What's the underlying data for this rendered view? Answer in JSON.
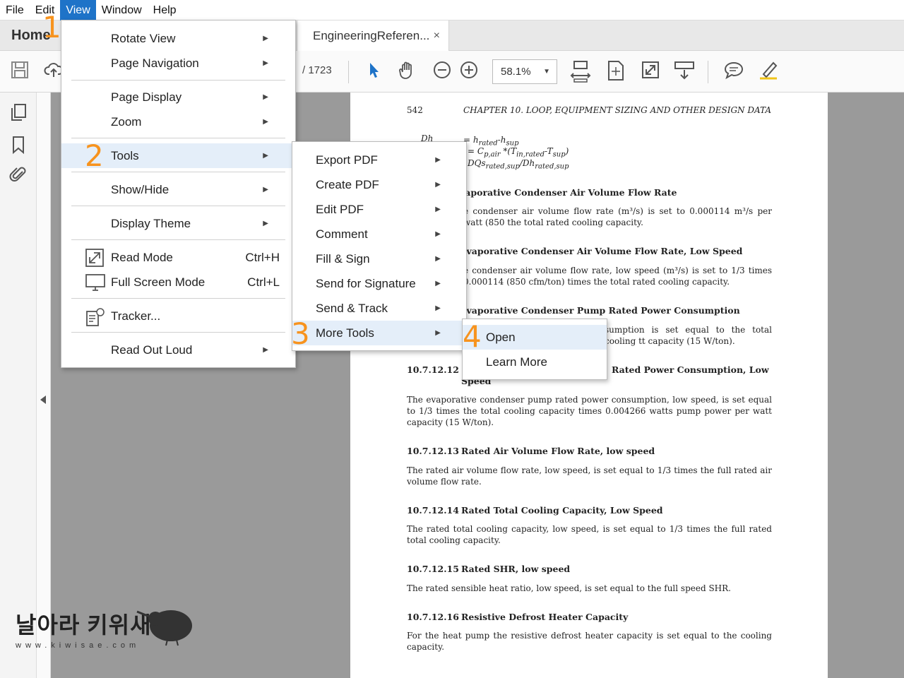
{
  "menubar": {
    "items": [
      "File",
      "Edit",
      "View",
      "Window",
      "Help"
    ],
    "active": "View"
  },
  "tabs": {
    "home": "Home",
    "document": "EngineeringReferen...",
    "close_glyph": "×"
  },
  "toolbar": {
    "page_total": "/ 1723",
    "zoom": "58.1%"
  },
  "view_menu": {
    "items": [
      {
        "label": "Rotate View",
        "has_submenu": true
      },
      {
        "label": "Page Navigation",
        "has_submenu": true
      },
      {
        "label": "Page Display",
        "has_submenu": true
      },
      {
        "label": "Zoom",
        "has_submenu": true
      },
      {
        "label": "Tools",
        "has_submenu": true,
        "highlighted": true
      },
      {
        "label": "Show/Hide",
        "has_submenu": true
      },
      {
        "label": "Display Theme",
        "has_submenu": true
      },
      {
        "label": "Read Mode",
        "shortcut": "Ctrl+H"
      },
      {
        "label": "Full Screen Mode",
        "shortcut": "Ctrl+L"
      },
      {
        "label": "Tracker..."
      },
      {
        "label": "Read Out Loud",
        "has_submenu": true
      }
    ]
  },
  "tools_menu": {
    "items": [
      {
        "label": "Export PDF"
      },
      {
        "label": "Create PDF"
      },
      {
        "label": "Edit PDF"
      },
      {
        "label": "Comment"
      },
      {
        "label": "Fill & Sign"
      },
      {
        "label": "Send for Signature"
      },
      {
        "label": "Send & Track"
      },
      {
        "label": "More Tools",
        "highlighted": true
      }
    ]
  },
  "more_tools_menu": {
    "items": [
      {
        "label": "Open",
        "highlighted": true
      },
      {
        "label": "Learn More"
      }
    ]
  },
  "steps": [
    "1",
    "2",
    "3",
    "4"
  ],
  "page": {
    "number": "542",
    "chapter": "CHAPTER 10.  LOOP, EQUIPMENT SIZING AND OTHER DESIGN DATA",
    "eq1_left": "Dh",
    "eq1_right": "= h",
    "eq2": "= C",
    "eq3": "DQs",
    "fragments": [
      {
        "head": "vaporative Condenser Air Volume Flow Rate",
        "body": "e condenser air volume flow rate (m³/s) is set to 0.000114 m³/s per watt (850 the total rated cooling capacity."
      },
      {
        "head": "Evaporative Condenser Air Volume Flow Rate, Low Speed",
        "body": "e condenser air volume flow rate, low speed (m³/s) is set to 1/3 times 0.000114 (850 cfm/ton) times the total rated cooling capacity."
      },
      {
        "head": "Evaporative Condenser Pump Rated Power Consumption",
        "body": "sumption is set equal to the total cooling tt capacity (15 W/ton)."
      }
    ],
    "sections": [
      {
        "num": "10.7.12.12",
        "title": "Rated Power Consumption, Low",
        "title2": "Speed",
        "body": "The evaporative condenser pump rated power consumption, low speed, is set equal to 1/3 times the total cooling capacity times 0.004266 watts pump power per watt capacity (15 W/ton)."
      },
      {
        "num": "10.7.12.13",
        "title": "Rated Air Volume Flow Rate, low speed",
        "body": "The rated air volume flow rate, low speed, is set equal to 1/3 times the full rated air volume flow rate."
      },
      {
        "num": "10.7.12.14",
        "title": "Rated Total Cooling Capacity, Low Speed",
        "body": "The rated total cooling capacity, low speed, is set equal to 1/3 times the full rated total cooling capacity."
      },
      {
        "num": "10.7.12.15",
        "title": "Rated SHR, low speed",
        "body": "The rated sensible heat ratio, low speed, is set equal to the full speed SHR."
      },
      {
        "num": "10.7.12.16",
        "title": "Resistive Defrost Heater Capacity",
        "body": "For the heat pump the resistive defrost heater capacity is set equal to the cooling capacity."
      }
    ]
  },
  "watermark": {
    "korean": "날아라 키위새",
    "url": "www.kiwisae.com"
  },
  "colors": {
    "accent": "#1e73c8",
    "step": "#f7931e",
    "highlight": "#e4eef9"
  }
}
